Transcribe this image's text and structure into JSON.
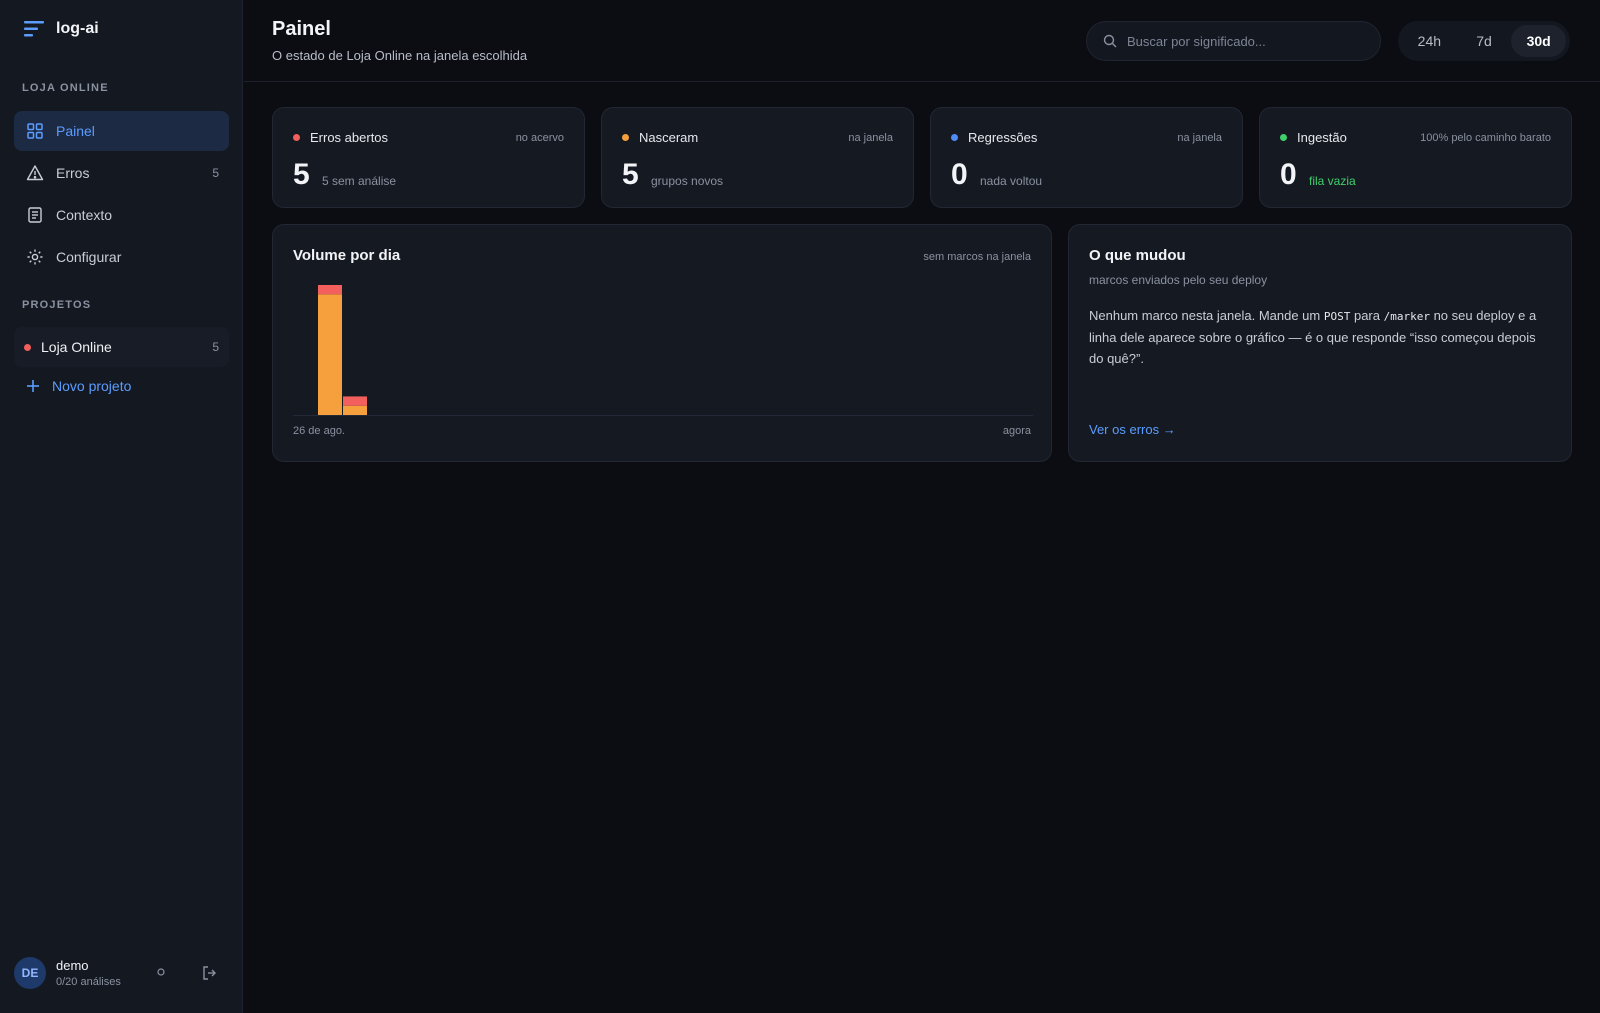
{
  "app": {
    "name": "log-ai"
  },
  "sidebar": {
    "section_label": "LOJA ONLINE",
    "items": [
      {
        "label": "Painel",
        "icon": "grid-icon",
        "active": true,
        "count": ""
      },
      {
        "label": "Erros",
        "icon": "warning-icon",
        "active": false,
        "count": "5"
      },
      {
        "label": "Contexto",
        "icon": "document-icon",
        "active": false,
        "count": ""
      },
      {
        "label": "Configurar",
        "icon": "gear-icon",
        "active": false,
        "count": ""
      }
    ],
    "projects_label": "PROJETOS",
    "projects": [
      {
        "label": "Loja Online",
        "count": "5",
        "color": "#f25f5c"
      }
    ],
    "new_project_label": "Novo projeto",
    "user": {
      "initials": "DE",
      "name": "demo",
      "usage": "0/20 análises"
    }
  },
  "header": {
    "title": "Painel",
    "subtitle": "O estado de Loja Online na janela escolhida",
    "search_placeholder": "Buscar por significado...",
    "ranges": [
      "24h",
      "7d",
      "30d"
    ],
    "active_range": "30d"
  },
  "stats": [
    {
      "label": "Erros abertos",
      "note": "no acervo",
      "value": "5",
      "sub": "5 sem análise",
      "dot_color": "#f25f5c",
      "sub_color": "#8a91a0"
    },
    {
      "label": "Nasceram",
      "note": "na janela",
      "value": "5",
      "sub": "grupos novos",
      "dot_color": "#f5a03c",
      "sub_color": "#8a91a0"
    },
    {
      "label": "Regressões",
      "note": "na janela",
      "value": "0",
      "sub": "nada voltou",
      "dot_color": "#4f8cf7",
      "sub_color": "#8a91a0"
    },
    {
      "label": "Ingestão",
      "note": "100% pelo caminho barato",
      "value": "0",
      "sub": "fila vazia",
      "dot_color": "#3fcf6b",
      "sub_color": "#3fcf6b"
    }
  ],
  "chart_card": {
    "title": "Volume por dia",
    "note": "sem marcos na janela",
    "x_start": "26 de ago.",
    "x_end": "agora"
  },
  "chart_data": {
    "type": "bar",
    "stacked": true,
    "x_start_label": "26 de ago.",
    "x_end_label": "agora",
    "days": 30,
    "series": [
      {
        "values": [
          13,
          1
        ],
        "color": "#f5a03c"
      },
      {
        "values": [
          1,
          1
        ],
        "color": "#f25f5c"
      }
    ],
    "ylim": [
      0,
      14
    ]
  },
  "changes": {
    "title": "O que mudou",
    "subtitle": "marcos enviados pelo seu deploy",
    "body_1": "Nenhum marco nesta janela. Mande um ",
    "code_1": "POST",
    "body_2": " para ",
    "code_2": "/marker",
    "body_3": " no seu deploy e a linha dele aparece sobre o gráfico — é o que responde “isso começou depois do quê?”.",
    "link": "Ver os erros →"
  },
  "colors": {
    "accent": "#5b9dff",
    "background": "#0b0d12",
    "card": "#151922"
  }
}
